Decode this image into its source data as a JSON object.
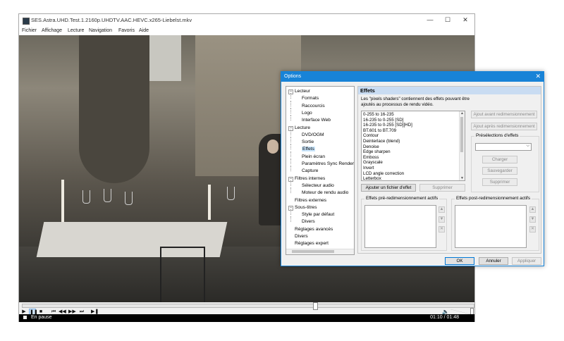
{
  "window": {
    "title": "SES.Astra.UHD.Test.1.2160p.UHDTV.AAC.HEVC.x265-Liebelst.mkv",
    "minimize": "—",
    "maximize": "☐",
    "close": "✕"
  },
  "menu": [
    "Fichier",
    "Affichage",
    "Lecture",
    "Navigation",
    "Favoris",
    "Aide"
  ],
  "controls": {
    "play": "▶",
    "pause": "❚❚",
    "stop": "■",
    "prev": "⏮",
    "rewind": "◀◀",
    "forward": "▶▶",
    "next": "⏭",
    "frame_step": "▶❚",
    "volume_icon": "🔈",
    "seek_position": 0.65,
    "volume_level": 1.0
  },
  "status": {
    "state": "En pause",
    "time": "01:10 / 01:48"
  },
  "dialog": {
    "title": "Options",
    "close": "✕",
    "tree": [
      {
        "label": "Lecteur",
        "level": 0,
        "expanded": true
      },
      {
        "label": "Formats",
        "level": 1
      },
      {
        "label": "Raccourcis",
        "level": 1
      },
      {
        "label": "Logo",
        "level": 1
      },
      {
        "label": "Interface Web",
        "level": 1
      },
      {
        "label": "Lecture",
        "level": 0,
        "expanded": true
      },
      {
        "label": "DVD/OGM",
        "level": 1
      },
      {
        "label": "Sortie",
        "level": 1
      },
      {
        "label": "Effets",
        "level": 1,
        "selected": true
      },
      {
        "label": "Plein écran",
        "level": 1
      },
      {
        "label": "Paramètres Sync Render",
        "level": 1
      },
      {
        "label": "Capture",
        "level": 1
      },
      {
        "label": "Filtres internes",
        "level": 0,
        "expanded": true
      },
      {
        "label": "Sélecteur audio",
        "level": 1
      },
      {
        "label": "Moteur de rendu audio",
        "level": 1
      },
      {
        "label": "Filtres externes",
        "level": 0
      },
      {
        "label": "Sous-titres",
        "level": 0,
        "expanded": true
      },
      {
        "label": "Style par défaut",
        "level": 1
      },
      {
        "label": "Divers",
        "level": 1
      },
      {
        "label": "Réglages avancés",
        "level": 0
      },
      {
        "label": "Divers",
        "level": 0
      },
      {
        "label": "Réglages expert",
        "level": 0
      }
    ],
    "panel": {
      "heading": "Effets",
      "description": "Les \"pixels shaders\" contiennent des effets pouvant être ajoutés au processus de rendu vidéo.",
      "effects": [
        "0-255 to 16-235",
        "16-235 to 0-255 [SD]",
        "16-235 to 0-255 [SD][HD]",
        "BT.601 to BT.709",
        "Contour",
        "Deinterlace (blend)",
        "Denoise",
        "Edge sharpen",
        "Emboss",
        "Grayscale",
        "Invert",
        "LCD angle correction",
        "Letterbox"
      ],
      "add_before_resize": "Ajout avant redimensionnement",
      "add_after_resize": "Ajout après redimensionnement",
      "presets_title": "Présélections d'effets",
      "preset_value": "",
      "load": "Charger",
      "save": "Sauvegarder",
      "delete_preset": "Supprimer",
      "add_file": "Ajouter un fichier d'effet",
      "delete": "Supprimer",
      "pre_resize_title": "Effets pré-redimensionnement actifs",
      "post_resize_title": "Effets post-redimensionnement actifs"
    },
    "ok": "OK",
    "cancel": "Annuler",
    "apply": "Appliquer"
  }
}
